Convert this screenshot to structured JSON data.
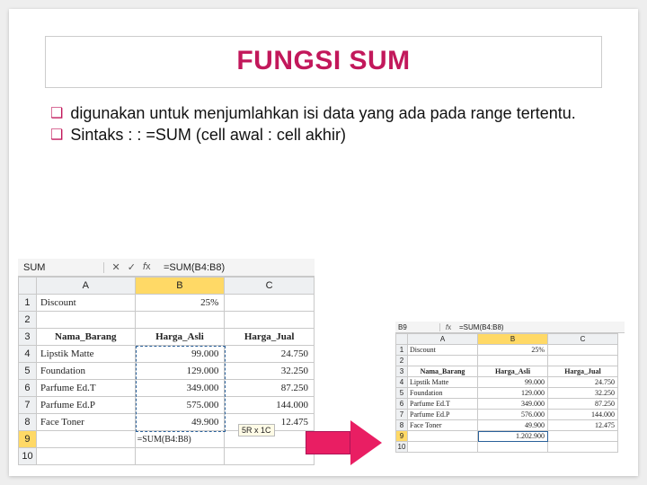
{
  "title": "FUNGSI SUM",
  "bullets": [
    "digunakan untuk menjumlahkan isi data yang ada pada range tertentu.",
    "Sintaks : : =SUM (cell awal : cell akhir)"
  ],
  "big": {
    "namebox": "SUM",
    "formula": "=SUM(B4:B8)",
    "colA": "A",
    "colB": "B",
    "colC": "C",
    "discount_label": "Discount",
    "discount_value": "25%",
    "h_name": "Nama_Barang",
    "h_price": "Harga_Asli",
    "h_sell": "Harga_Jual",
    "rows": [
      {
        "n": "Lipstik Matte",
        "p": "99.000",
        "s": "24.750"
      },
      {
        "n": "Foundation",
        "p": "129.000",
        "s": "32.250"
      },
      {
        "n": "Parfume Ed.T",
        "p": "349.000",
        "s": "87.250"
      },
      {
        "n": "Parfume Ed.P",
        "p": "575.000",
        "s": "144.000"
      },
      {
        "n": "Face Toner",
        "p": "49.900",
        "s": "12.475"
      }
    ],
    "sum_formula": "=SUM(B4:B8)",
    "size_hint": "5R x 1C"
  },
  "small": {
    "namebox": "B9",
    "formula": "=SUM(B4:B8)",
    "colA": "A",
    "colB": "B",
    "colC": "C",
    "discount_label": "Discount",
    "discount_value": "25%",
    "h_name": "Nama_Barang",
    "h_price": "Harga_Asli",
    "h_sell": "Harga_Jual",
    "rows": [
      {
        "n": "Lipstik Matte",
        "p": "99.000",
        "s": "24.750"
      },
      {
        "n": "Foundation",
        "p": "129.000",
        "s": "32.250"
      },
      {
        "n": "Parfume Ed.T",
        "p": "349.000",
        "s": "87.250"
      },
      {
        "n": "Parfume Ed.P",
        "p": "576.000",
        "s": "144.000"
      },
      {
        "n": "Face Toner",
        "p": "49.900",
        "s": "12.475"
      }
    ],
    "sum_result": "1.202.900"
  }
}
